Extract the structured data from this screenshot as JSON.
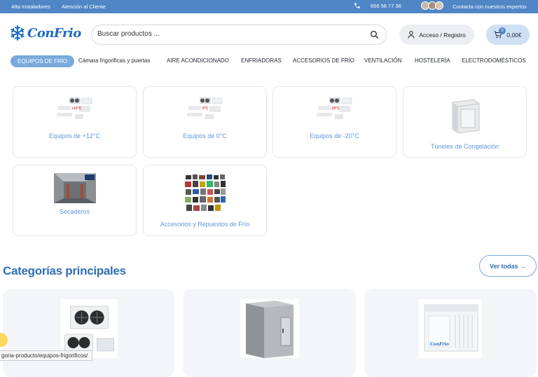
{
  "topbar": {
    "links": [
      "Alta Instaladores",
      "Atención al Cliente"
    ],
    "phone": "656 56 77 36",
    "contact": "Contacta con nuestros expertos"
  },
  "header": {
    "logo_text": "ConFrio",
    "search_placeholder": "Buscar productos ...",
    "account_label": "Acceso / Registro",
    "cart_count": "0",
    "cart_total": "0,00€"
  },
  "nav": {
    "items": [
      "EQUIPOS DE FRÍO",
      "Cámara frigorificas y puertas",
      "AIRE ACONDICIONADO",
      "ENFRIADORAS",
      "ACCESORIOS DE FRÍO",
      "VENTILACIÓN",
      "HOSTELERÍA",
      "ELECTRODOMÉSTICOS"
    ]
  },
  "subcategories": [
    {
      "label": "Equipos de +12°C",
      "badge": "+12°C"
    },
    {
      "label": "Equipos de 0°C",
      "badge": "0°C"
    },
    {
      "label": "Equipos de -20°C",
      "badge": "-20°C"
    },
    {
      "label": "Túneles de Congelación"
    },
    {
      "label": "Secaderos"
    },
    {
      "label": "Accesorios y Repuestos de Frío"
    }
  ],
  "main_categories": {
    "title": "Categorías principales",
    "view_all": "Ver todas →"
  },
  "status_bar": {
    "url": "goria-producto/equipos-frigorificos/"
  },
  "colors": {
    "topbar": "#4f86c6",
    "accent": "#2f6fb7",
    "link": "#5e96d6",
    "active_nav": "#7aa9dc",
    "cart_bg": "#cfe0f5"
  }
}
